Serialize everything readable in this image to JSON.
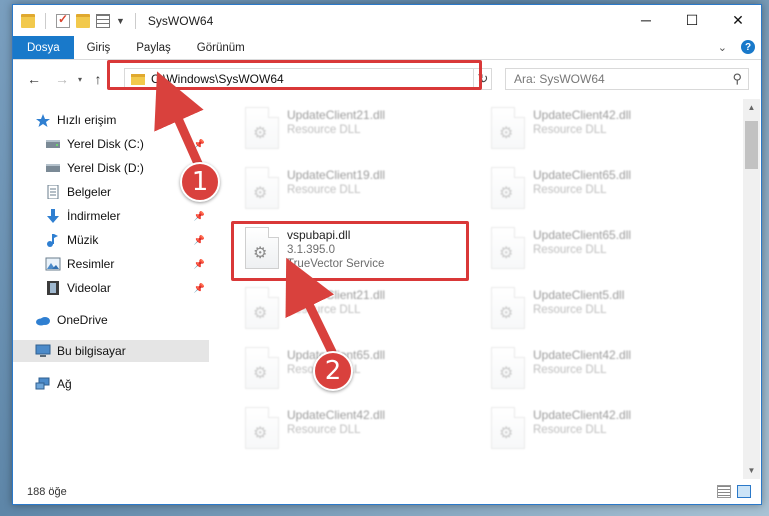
{
  "window": {
    "title": "SysWOW64",
    "controls": {
      "minimize": "─",
      "maximize": "☐",
      "close": "✕"
    }
  },
  "ribbon": {
    "tabs": [
      "Dosya",
      "Giriş",
      "Paylaş",
      "Görünüm"
    ],
    "expand_icon": "chevron-down-icon",
    "help": "?"
  },
  "navigation": {
    "back": "←",
    "forward": "→",
    "recent": "▾",
    "up": "↑",
    "address_path": "C:\\Windows\\SysWOW64",
    "address_dropdown": "⌄",
    "refresh": "↻",
    "search_placeholder": "Ara: SysWOW64",
    "search_icon": "⚲"
  },
  "sidebar": {
    "items": [
      {
        "label": "Hızlı erişim",
        "icon": "star-icon",
        "pinned": false
      },
      {
        "label": "Yerel Disk (C:)",
        "icon": "drive-icon",
        "pinned": true
      },
      {
        "label": "Yerel Disk (D:)",
        "icon": "drive-icon",
        "pinned": true
      },
      {
        "label": "Belgeler",
        "icon": "documents-icon",
        "pinned": true
      },
      {
        "label": "İndirmeler",
        "icon": "download-icon",
        "pinned": true
      },
      {
        "label": "Müzik",
        "icon": "music-icon",
        "pinned": true
      },
      {
        "label": "Resimler",
        "icon": "pictures-icon",
        "pinned": true
      },
      {
        "label": "Videolar",
        "icon": "videos-icon",
        "pinned": true
      },
      {
        "label": "OneDrive",
        "icon": "cloud-icon",
        "pinned": false
      },
      {
        "label": "Bu bilgisayar",
        "icon": "computer-icon",
        "pinned": false
      },
      {
        "label": "Ağ",
        "icon": "network-icon",
        "pinned": false
      }
    ],
    "pin_glyph": "📌"
  },
  "files": {
    "left_column": [
      {
        "name": "UpdateClient21.dll",
        "meta": "Resource DLL"
      },
      {
        "name": "UpdateClient19.dll",
        "meta": "Resource DLL"
      },
      {
        "name": "vspubapi.dll",
        "version": "3.1.395.0",
        "company": "TrueVector Service"
      },
      {
        "name": "UpdateClient21.dll",
        "meta": "Resource DLL"
      },
      {
        "name": "UpdateClient65.dll",
        "meta": "Resource DLL"
      },
      {
        "name": "UpdateClient42.dll",
        "meta": "Resource DLL"
      }
    ],
    "right_column": [
      {
        "name": "UpdateClient42.dll",
        "meta": "Resource DLL"
      },
      {
        "name": "UpdateClient65.dll",
        "meta": "Resource DLL"
      },
      {
        "name": "UpdateClient65.dll",
        "meta": "Resource DLL"
      },
      {
        "name": "UpdateClient5.dll",
        "meta": "Resource DLL"
      },
      {
        "name": "UpdateClient42.dll",
        "meta": "Resource DLL"
      },
      {
        "name": "UpdateClient42.dll",
        "meta": "Resource DLL"
      }
    ]
  },
  "status": {
    "count": "188 öğe"
  },
  "callouts": {
    "one": "1",
    "two": "2"
  },
  "colors": {
    "accent": "#1979ca",
    "annotation_red": "#d93838"
  }
}
